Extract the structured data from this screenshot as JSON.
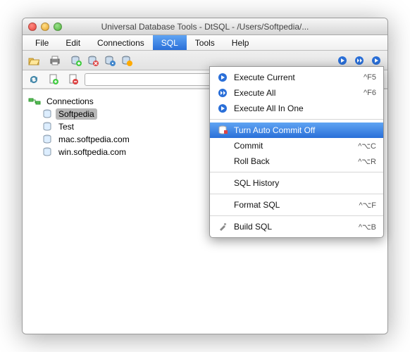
{
  "window": {
    "title": "Universal Database Tools - DtSQL - /Users/Softpedia/..."
  },
  "menubar": {
    "file": "File",
    "edit": "Edit",
    "connections": "Connections",
    "sql": "SQL",
    "tools": "Tools",
    "help": "Help",
    "active": "sql"
  },
  "tree": {
    "root": "Connections",
    "items": [
      {
        "label": "Softpedia",
        "selected": true
      },
      {
        "label": "Test"
      },
      {
        "label": "mac.softpedia.com"
      },
      {
        "label": "win.softpedia.com"
      }
    ]
  },
  "dropdown": {
    "execute_current": {
      "label": "Execute Current",
      "accel": "^F5"
    },
    "execute_all": {
      "label": "Execute All",
      "accel": "^F6"
    },
    "execute_allinone": {
      "label": "Execute All In One",
      "accel": ""
    },
    "auto_commit": {
      "label": "Turn Auto Commit Off",
      "accel": ""
    },
    "commit": {
      "label": "Commit",
      "accel": "^⌥C"
    },
    "rollback": {
      "label": "Roll Back",
      "accel": "^⌥R"
    },
    "history": {
      "label": "SQL History",
      "accel": ""
    },
    "format": {
      "label": "Format SQL",
      "accel": "^⌥F"
    },
    "build": {
      "label": "Build SQL",
      "accel": "^⌥B"
    }
  },
  "search": {
    "placeholder": ""
  }
}
